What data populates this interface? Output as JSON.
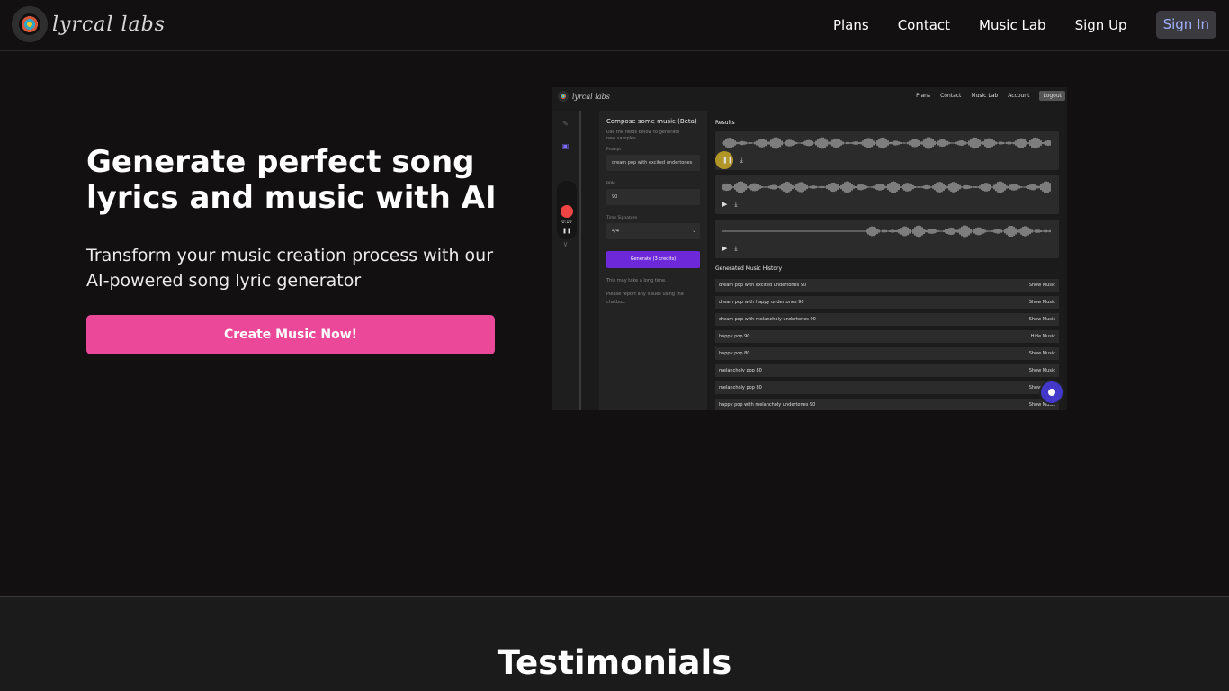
{
  "brand": {
    "logo_text": "lyrcal labs"
  },
  "nav": {
    "links": [
      "Plans",
      "Contact",
      "Music Lab",
      "Sign Up"
    ],
    "signin": "Sign In"
  },
  "hero": {
    "title": "Generate perfect song lyrics and music with AI",
    "subtitle": "Transform your music creation process with our AI-powered song lyric generator",
    "cta": "Create Music Now!"
  },
  "screenshot": {
    "logo_text": "lyrcal labs",
    "nav": [
      "Plans",
      "Contact",
      "Music Lab",
      "Account"
    ],
    "logout": "Logout",
    "recorder_time": "0:10",
    "form": {
      "title": "Compose some music (Beta)",
      "help": "Use the fields below to generate new samples.",
      "prompt_label": "Prompt",
      "prompt_value": "dream pop with excited undertones",
      "bpm_label": "BPM",
      "bpm_value": "90",
      "time_sig_label": "Time Signature",
      "time_sig_value": "4/4",
      "generate_button": "Generate (3 credits)",
      "note1": "This may take a long time.",
      "note2": "Please report any issues using the chatbox."
    },
    "results_heading": "Results",
    "history_heading": "Generated Music History",
    "history": [
      {
        "name": "dream pop with excited undertones 90",
        "action": "Show Music"
      },
      {
        "name": "dream pop with happy undertones 90",
        "action": "Show Music"
      },
      {
        "name": "dream pop with melancholy undertones 90",
        "action": "Show Music"
      },
      {
        "name": "happy pop 90",
        "action": "Hide Music"
      },
      {
        "name": "happy pop 80",
        "action": "Show Music"
      },
      {
        "name": "melancholy pop 80",
        "action": "Show Music"
      },
      {
        "name": "melancholy pop 80",
        "action": "Show Music"
      },
      {
        "name": "happy pop with melancholy undertones 90",
        "action": "Show Music"
      }
    ]
  },
  "testimonials": {
    "title": "Testimonials"
  },
  "colors": {
    "accent": "#ec4899",
    "primary": "#6d28d9",
    "background": "#121011"
  }
}
